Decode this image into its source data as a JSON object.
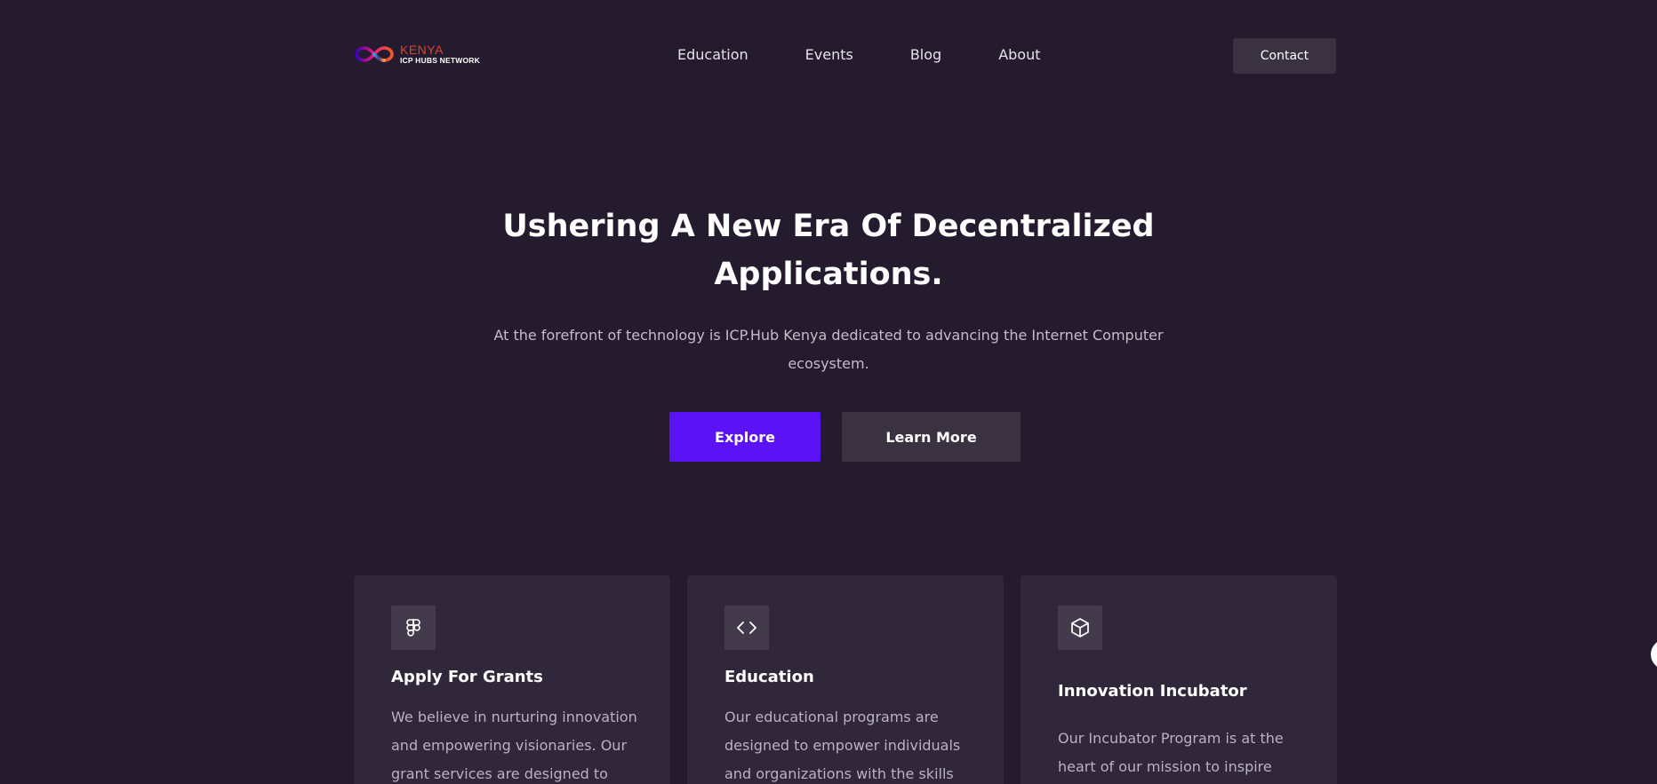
{
  "header": {
    "logo": {
      "title": "KENYA",
      "subtitle": "ICP HUBS NETWORK"
    },
    "nav": [
      "Education",
      "Events",
      "Blog",
      "About"
    ],
    "contact_label": "Contact"
  },
  "hero": {
    "title_lines": [
      "Ushering A New Era Of Decentralized",
      "Applications."
    ],
    "subtitle_lines": [
      "At the forefront of technology is ICP.Hub Kenya dedicated to advancing the Internet Computer",
      "ecosystem."
    ],
    "explore_label": "Explore",
    "learn_more_label": "Learn More"
  },
  "cards": [
    {
      "icon": "figma-icon",
      "title": "Apply For Grants",
      "text": "We believe in nurturing innovation and empowering visionaries. Our grant services are designed to"
    },
    {
      "icon": "code-icon",
      "title": "Education",
      "text": "Our educational programs are designed to empower individuals and organizations with the skills"
    },
    {
      "icon": "box-icon",
      "title": "Innovation Incubator",
      "text": "Our Incubator Program is at the heart of our mission to inspire"
    }
  ],
  "colors": {
    "background": "#251b2e",
    "card": "#30283a",
    "primary_button": "#5b12f7",
    "secondary_button": "#3a3240",
    "logo_kenya": "#d6452f"
  }
}
